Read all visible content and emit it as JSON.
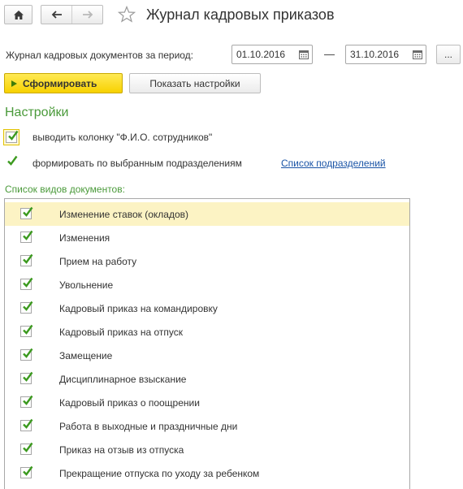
{
  "header": {
    "title": "Журнал кадровых приказов"
  },
  "period": {
    "label": "Журнал кадровых документов за период:",
    "from": "01.10.2016",
    "separator": "—",
    "to": "31.10.2016",
    "more_label": "..."
  },
  "toolbar": {
    "generate_label": "Сформировать",
    "show_settings_label": "Показать настройки"
  },
  "settings": {
    "title": "Настройки",
    "options": [
      {
        "label": "выводить колонку \"Ф.И.О. сотрудников\"",
        "checked": true
      },
      {
        "label": "формировать по выбранным  подразделениям",
        "checked": true
      }
    ],
    "departments_link": "Список подразделений"
  },
  "doc_types": {
    "caption": "Список видов документов:",
    "items": [
      {
        "label": "Изменение ставок (окладов)",
        "checked": true,
        "selected": true
      },
      {
        "label": "Изменения",
        "checked": true
      },
      {
        "label": "Прием на работу",
        "checked": true
      },
      {
        "label": "Увольнение",
        "checked": true
      },
      {
        "label": "Кадровый приказ на командировку",
        "checked": true
      },
      {
        "label": "Кадровый приказ на отпуск",
        "checked": true
      },
      {
        "label": "Замещение",
        "checked": true
      },
      {
        "label": "Дисциплинарное взыскание",
        "checked": true
      },
      {
        "label": "Кадровый приказ о поощрении",
        "checked": true
      },
      {
        "label": "Работа в выходные и праздничные дни",
        "checked": true
      },
      {
        "label": "Приказ на отзыв из отпуска",
        "checked": true
      },
      {
        "label": "Прекращение отпуска по уходу за ребенком",
        "checked": true
      }
    ]
  },
  "colors": {
    "accent_green": "#4a9a3a",
    "check_green": "#3c9a1f",
    "primary_yellow": "#f7d100",
    "selected_row": "#fcf3c4",
    "link_blue": "#1a54a6"
  }
}
